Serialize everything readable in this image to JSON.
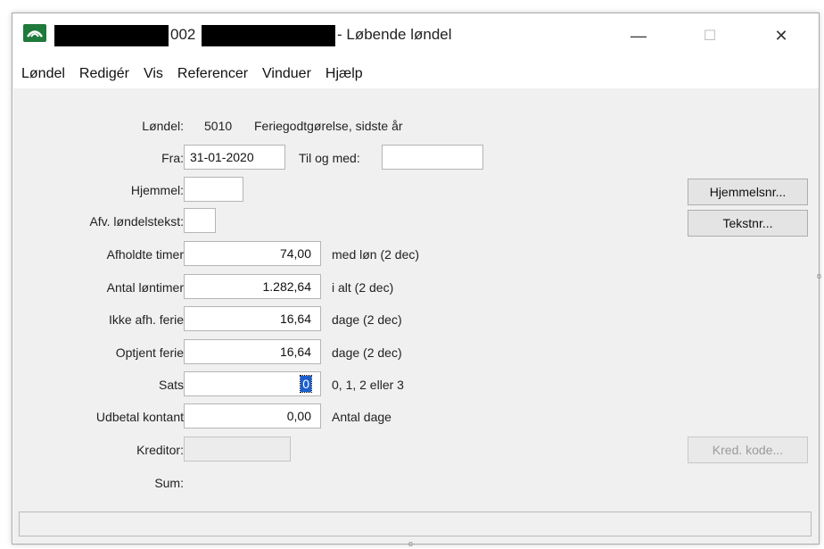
{
  "window": {
    "title_code": "002",
    "title_suffix": "- Løbende løndel",
    "icon": "bank-app-icon"
  },
  "controls": {
    "minimize": "—",
    "maximize": "☐",
    "close": "✕"
  },
  "menu": [
    "Løndel",
    "Redigér",
    "Vis",
    "Referencer",
    "Vinduer",
    "Hjælp"
  ],
  "form": {
    "londel_label": "Løndel:",
    "londel_code": "5010",
    "londel_name": "Feriegodtgørelse, sidste år",
    "fra_label": "Fra:",
    "fra_value": "31-01-2020",
    "tilogmed_label": "Til og med:",
    "tilogmed_value": "",
    "hjemmel_label": "Hjemmel:",
    "hjemmel_value": "",
    "afv_label": "Afv. løndelstekst:",
    "afv_value": "",
    "afholdte_label": "Afholdte timer",
    "afholdte_value": "74,00",
    "afholdte_unit": "med løn (2 dec)",
    "antal_label": "Antal løntimer",
    "antal_value": "1.282,64",
    "antal_unit": "i alt (2 dec)",
    "ikke_label": "Ikke afh. ferie",
    "ikke_value": "16,64",
    "ikke_unit": "dage (2 dec)",
    "optjent_label": "Optjent ferie",
    "optjent_value": "16,64",
    "optjent_unit": "dage (2 dec)",
    "sats_label": "Sats",
    "sats_value": "0",
    "sats_hint": "0, 1, 2 eller 3",
    "udbetal_label": "Udbetal kontant",
    "udbetal_value": "0,00",
    "udbetal_unit": "Antal dage",
    "kreditor_label": "Kreditor:",
    "kreditor_value": "",
    "sum_label": "Sum:"
  },
  "buttons": {
    "hjemmelsnr": "Hjemmelsnr...",
    "tekstnr": "Tekstnr...",
    "kred_kode": "Kred. kode..."
  },
  "status": "",
  "colors": {
    "selection": "#1a5fd1",
    "client_bg": "#f0f0f0",
    "icon_green": "#1f7a3b"
  }
}
